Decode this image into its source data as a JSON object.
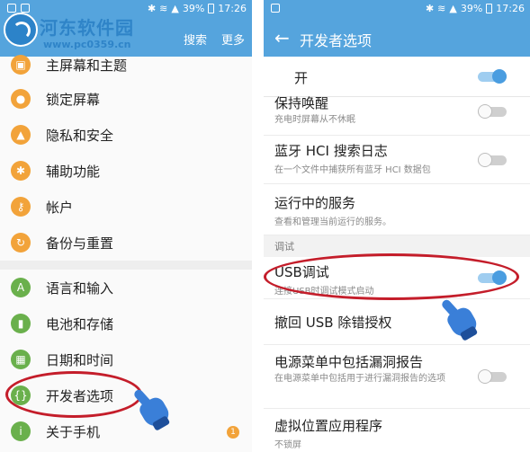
{
  "status_bar": {
    "battery": "39%",
    "time": "17:26"
  },
  "watermark": {
    "title": "河东软件园",
    "url": "www.pc0359.cn"
  },
  "left": {
    "actions": [
      "搜索",
      "更多"
    ],
    "items": [
      {
        "label": "主屏幕和主题",
        "icon": "home-theme-icon",
        "color": "#f2a33a",
        "glyph": "▣"
      },
      {
        "label": "锁定屏幕",
        "icon": "lock-icon",
        "color": "#f2a33a",
        "glyph": "●"
      },
      {
        "label": "隐私和安全",
        "icon": "privacy-icon",
        "color": "#f2a33a",
        "glyph": "▲"
      },
      {
        "label": "辅助功能",
        "icon": "accessibility-icon",
        "color": "#f2a33a",
        "glyph": "✱"
      },
      {
        "label": "帐户",
        "icon": "key-icon",
        "color": "#f2a33a",
        "glyph": "⚷"
      },
      {
        "label": "备份与重置",
        "icon": "backup-icon",
        "color": "#f2a33a",
        "glyph": "↻"
      },
      {
        "label": "语言和输入",
        "icon": "language-icon",
        "color": "#6ab04c",
        "glyph": "A"
      },
      {
        "label": "电池和存储",
        "icon": "battery-icon",
        "color": "#6ab04c",
        "glyph": "▮"
      },
      {
        "label": "日期和时间",
        "icon": "calendar-icon",
        "color": "#6ab04c",
        "glyph": "▦"
      },
      {
        "label": "开发者选项",
        "icon": "developer-icon",
        "color": "#6ab04c",
        "glyph": "{}"
      },
      {
        "label": "关于手机",
        "icon": "info-icon",
        "color": "#6ab04c",
        "glyph": "i",
        "badge": "1"
      }
    ]
  },
  "right": {
    "title": "开发者选项",
    "master_label": "开",
    "master_on": true,
    "section_header": "调试",
    "rows": [
      {
        "title": "保持唤醒",
        "subtitle": "充电时屏幕从不休眠",
        "toggle": "off"
      },
      {
        "title": "蓝牙 HCI 搜索日志",
        "subtitle": "在一个文件中捕获所有蓝牙 HCI 数据包",
        "toggle": "off"
      },
      {
        "title": "运行中的服务",
        "subtitle": "查看和管理当前运行的服务。",
        "toggle": "none"
      },
      {
        "title": "USB调试",
        "subtitle": "连接USB时调试模式启动",
        "toggle": "on"
      },
      {
        "title": "撤回 USB 除错授权",
        "subtitle": "",
        "toggle": "none"
      },
      {
        "title": "电源菜单中包括漏洞报告",
        "subtitle": "在电源菜单中包括用于进行漏洞报告的选项",
        "toggle": "off"
      },
      {
        "title": "虚拟位置应用程序",
        "subtitle": "不锁屏",
        "toggle": "none"
      }
    ]
  },
  "colors": {
    "accent": "#55a4dd",
    "highlight": "#c41d2a",
    "toggle_on": "#4a9de0"
  }
}
